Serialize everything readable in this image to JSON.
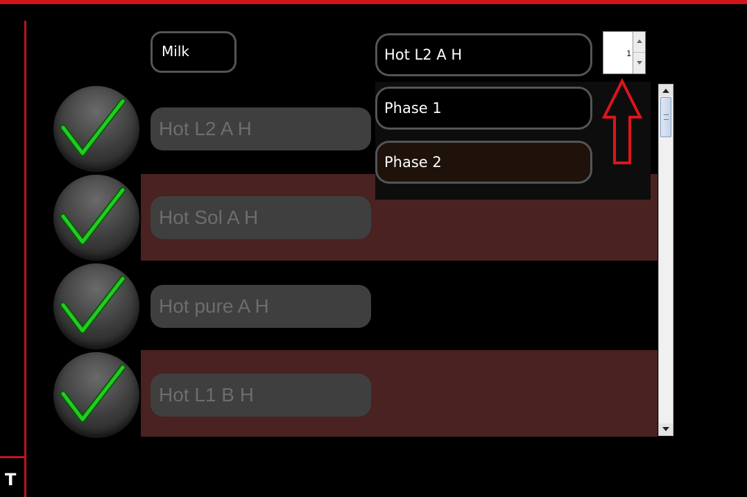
{
  "field": {
    "label": "Milk"
  },
  "items": [
    {
      "label": "Hot L2 A H"
    },
    {
      "label": "Hot Sol A H"
    },
    {
      "label": "Hot pure A H"
    },
    {
      "label": "Hot L1 B H"
    }
  ],
  "dropdown": {
    "selected": "Hot L2 A H",
    "options": [
      "Phase 1",
      "Phase 2"
    ]
  },
  "spinner": {
    "value": "1"
  },
  "left_panel": {
    "letter": "T"
  },
  "colors": {
    "accent_red": "#d1141c",
    "row_band": "#4a2222",
    "check_green": "#22cc22"
  },
  "icons": [
    "check-icon",
    "arrow-up-icon"
  ]
}
